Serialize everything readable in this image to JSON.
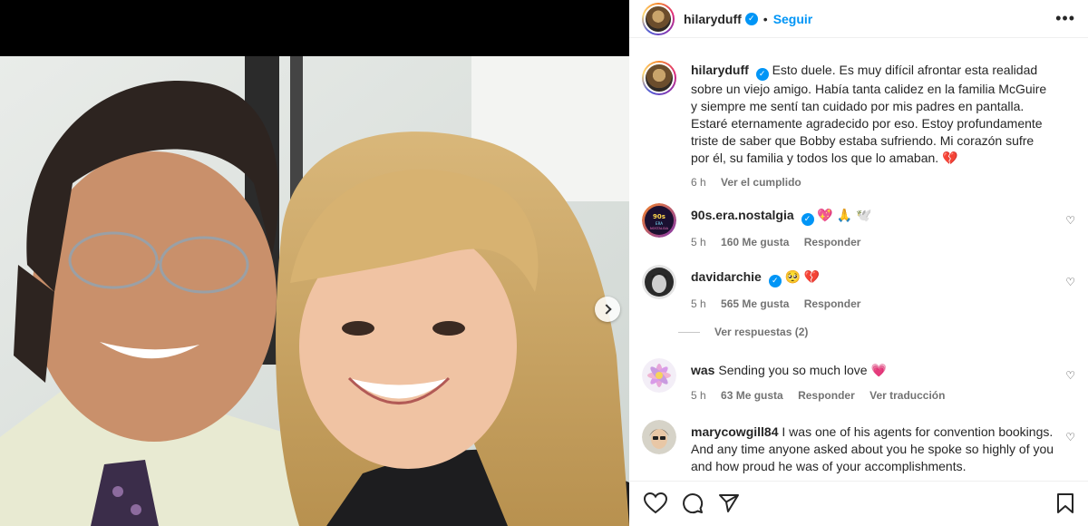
{
  "post": {
    "username": "hilaryduff",
    "follow_label": "Seguir",
    "separator": "•",
    "more_label": "•••",
    "verified_mark": "✓",
    "caption": "Esto duele. Es muy difícil afrontar esta realidad sobre un viejo amigo. Había tanta calidez en la familia McGuire y siempre me sentí tan cuidado por mis padres en pantalla. Estaré eternamente agradecido por eso. Estoy profundamente triste de saber que Bobby estaba sufriendo. Mi corazón sufre por él, su familia y todos los que lo amaban.",
    "caption_emoji": "💔",
    "time": "6 h",
    "translate": "Ver el cumplido"
  },
  "comments": [
    {
      "username": "90s.era.nostalgia",
      "verified": true,
      "text": "",
      "emoji": "💖 🙏 🕊️",
      "time": "5 h",
      "likes": "160 Me gusta",
      "reply": "Responder",
      "avatar_text": "90s ERA NOSTALGIA"
    },
    {
      "username": "davidarchie",
      "verified": true,
      "text": "",
      "emoji": "🥺 💔",
      "time": "5 h",
      "likes": "565 Me gusta",
      "reply": "Responder",
      "view_replies": "Ver respuestas (2)"
    },
    {
      "username": "was",
      "verified": false,
      "text": "Sending you so much love",
      "emoji": "💗",
      "time": "5 h",
      "likes": "63 Me gusta",
      "reply": "Responder",
      "translate": "Ver traducción"
    },
    {
      "username": "marycowgill84",
      "verified": false,
      "text": "I was one of his agents for convention bookings. And any time anyone asked about you he spoke so highly of you and how proud he was of your accomplishments."
    }
  ],
  "icons": [
    "heart-icon",
    "comment-icon",
    "share-icon",
    "bookmark-icon",
    "chevron-right-icon",
    "verified-icon",
    "more-icon"
  ],
  "colors": {
    "accent": "#0095f6",
    "text": "#262626",
    "muted": "#737373",
    "heart": "#e4405f"
  }
}
